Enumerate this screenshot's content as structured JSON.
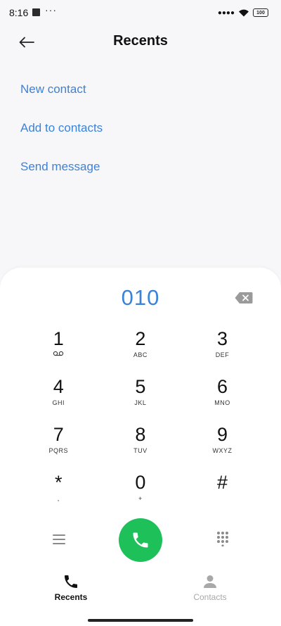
{
  "status_bar": {
    "time": "8:16",
    "dots": "···",
    "signal": "●●●●",
    "battery": "100"
  },
  "header": {
    "title": "Recents",
    "back_icon": "arrow-left-icon"
  },
  "actions": {
    "new_contact": "New contact",
    "add_to_contacts": "Add to contacts",
    "send_message": "Send message"
  },
  "dialer": {
    "number": "010",
    "keys": [
      {
        "digit": "1",
        "letters": ""
      },
      {
        "digit": "2",
        "letters": "ABC"
      },
      {
        "digit": "3",
        "letters": "DEF"
      },
      {
        "digit": "4",
        "letters": "GHI"
      },
      {
        "digit": "5",
        "letters": "JKL"
      },
      {
        "digit": "6",
        "letters": "MNO"
      },
      {
        "digit": "7",
        "letters": "PQRS"
      },
      {
        "digit": "8",
        "letters": "TUV"
      },
      {
        "digit": "9",
        "letters": "WXYZ"
      },
      {
        "digit": "*",
        "letters": ","
      },
      {
        "digit": "0",
        "letters": "+"
      },
      {
        "digit": "#",
        "letters": ""
      }
    ]
  },
  "bottom_nav": {
    "recents": "Recents",
    "contacts": "Contacts"
  },
  "colors": {
    "accent": "#3b82d9",
    "call": "#1ec05a",
    "background": "#f7f7f9"
  }
}
